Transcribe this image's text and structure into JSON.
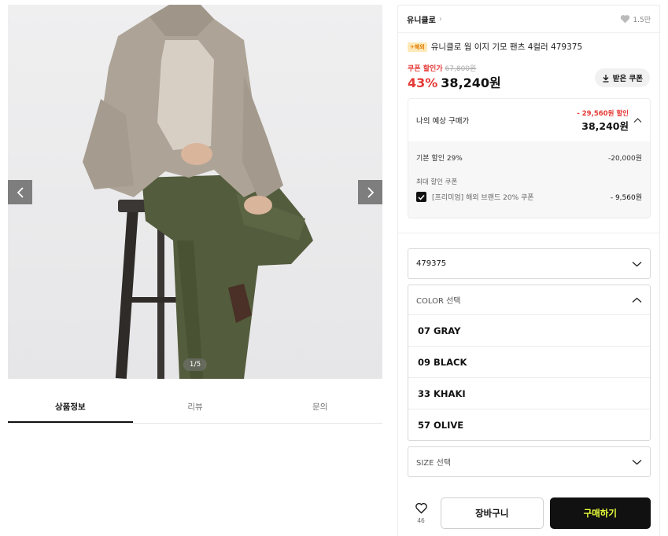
{
  "gallery": {
    "page_indicator": "1/5"
  },
  "tabs": [
    {
      "label": "상품정보",
      "active": true
    },
    {
      "label": "리뷰",
      "active": false
    },
    {
      "label": "문의",
      "active": false
    }
  ],
  "product": {
    "brand": "유니클로",
    "like_count": "1.5만",
    "badge": "해외",
    "title": "유니클로 웜 이지 기모 팬츠 4컬러 479375",
    "coupon_price_label": "쿠폰 할인가",
    "original_price": "67,800원",
    "discount_percent": "43%",
    "price": "38,240원",
    "coupon_button_label": "받은 쿠폰"
  },
  "estimate": {
    "label": "나의 예상 구매가",
    "discount": "- 29,560원 할인",
    "price": "38,240원",
    "basic_label": "기본 할인 29%",
    "basic_value": "-20,000원",
    "coupon_section_label": "최대 할인 쿠폰",
    "coupon_name": "[프리미엄] 해외 브랜드 20% 쿠폰",
    "coupon_value": "- 9,560원"
  },
  "options": {
    "model": "479375",
    "color_placeholder": "COLOR 선택",
    "colors": [
      "07 GRAY",
      "09 BLACK",
      "33 KHAKI",
      "57 OLIVE"
    ],
    "size_placeholder": "SIZE 선택"
  },
  "actions": {
    "like_count": "46",
    "cart_label": "장바구니",
    "buy_label": "구매하기"
  },
  "colors": {
    "accent_red": "#e53935",
    "buy_text": "#e8ff3a",
    "buy_bg": "#111111"
  }
}
